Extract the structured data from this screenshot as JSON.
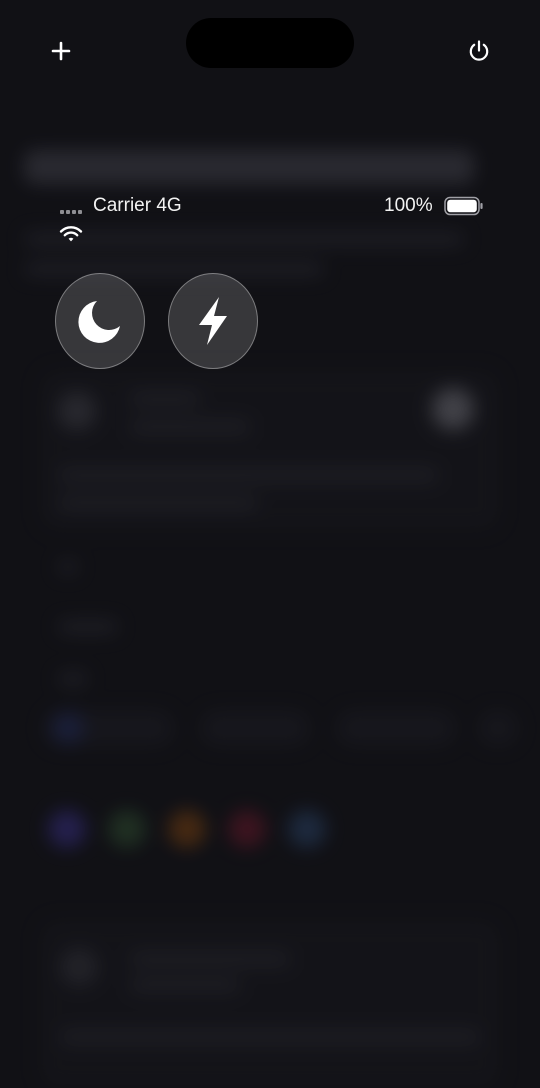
{
  "status_bar": {
    "carrier": "Carrier 4G",
    "battery_percent": "100%",
    "battery_level": 1.0
  },
  "controls": {
    "left_icon": "plus-icon",
    "right_icon": "power-icon",
    "mode_buttons": [
      {
        "icon": "moon-icon"
      },
      {
        "icon": "bolt-icon"
      }
    ]
  },
  "colors": {
    "background": "#141418",
    "foreground": "#ffffff"
  }
}
